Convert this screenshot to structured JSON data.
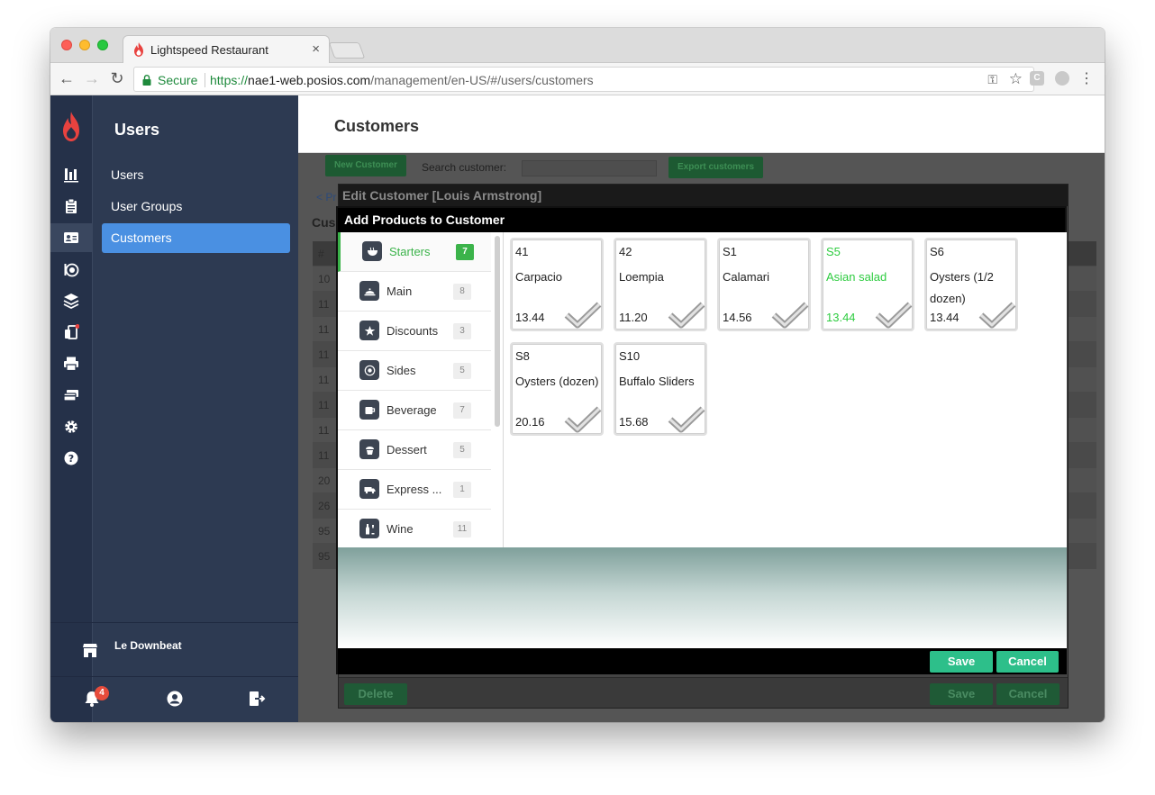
{
  "browser": {
    "tab_title": "Lightspeed Restaurant",
    "tab_close": "×",
    "secure_label": "Secure",
    "url_scheme": "https://",
    "url_host": "nae1-web.posios.com",
    "url_path": "/management/en-US/#/users/customers",
    "extension_labels": [
      "C",
      ""
    ]
  },
  "sidebar": {
    "title": "Users",
    "items": [
      {
        "label": "Users"
      },
      {
        "label": "User Groups"
      },
      {
        "label": "Customers"
      }
    ],
    "store_name": "Le Downbeat",
    "notification_count": "4"
  },
  "main": {
    "title": "Customers",
    "new_customer_label": "New Customer",
    "search_label": "Search customer:",
    "export_label": "Export customers",
    "pager_label": "< Pr",
    "section_label": "Cus",
    "table_head": "#",
    "row_ids": [
      "10",
      "11",
      "11",
      "11",
      "11",
      "11",
      "11",
      "11",
      "20",
      "26",
      "95",
      "95"
    ]
  },
  "edit_modal": {
    "title": "Edit Customer [Louis Armstrong]",
    "delete_label": "Delete",
    "save_label": "Save",
    "cancel_label": "Cancel"
  },
  "products_modal": {
    "title": "Add Products to Customer",
    "categories": [
      {
        "label": "Starters",
        "count": "7",
        "icon": "bowl-icon"
      },
      {
        "label": "Main",
        "count": "8",
        "icon": "cloche-icon"
      },
      {
        "label": "Discounts",
        "count": "3",
        "icon": "star-icon"
      },
      {
        "label": "Sides",
        "count": "5",
        "icon": "plate-icon"
      },
      {
        "label": "Beverage",
        "count": "7",
        "icon": "cup-icon"
      },
      {
        "label": "Dessert",
        "count": "5",
        "icon": "cupcake-icon"
      },
      {
        "label": "Express ...",
        "count": "1",
        "icon": "truck-icon"
      },
      {
        "label": "Wine",
        "count": "11",
        "icon": "bottle-icon"
      }
    ],
    "products": [
      {
        "code": "41",
        "name": "Carpacio",
        "price": "13.44",
        "highlight": false
      },
      {
        "code": "42",
        "name": "Loempia",
        "price": "11.20",
        "highlight": false
      },
      {
        "code": "S1",
        "name": "Calamari",
        "price": "14.56",
        "highlight": false
      },
      {
        "code": "S5",
        "name": "Asian salad",
        "price": "13.44",
        "highlight": true
      },
      {
        "code": "S6",
        "name": "Oysters (1/2 dozen)",
        "price": "13.44",
        "highlight": false
      },
      {
        "code": "S8",
        "name": "Oysters (dozen)",
        "price": "20.16",
        "highlight": false
      },
      {
        "code": "S10",
        "name": "Buffalo Sliders",
        "price": "15.68",
        "highlight": false
      }
    ],
    "save_label": "Save",
    "cancel_label": "Cancel"
  },
  "colors": {
    "brand_red": "#e8423f",
    "sidebar_bg": "#2d3a52",
    "rail_bg": "#253149",
    "active_blue": "#4a90e2",
    "accent_green": "#3bb34a",
    "button_teal": "#2dbf8a"
  }
}
